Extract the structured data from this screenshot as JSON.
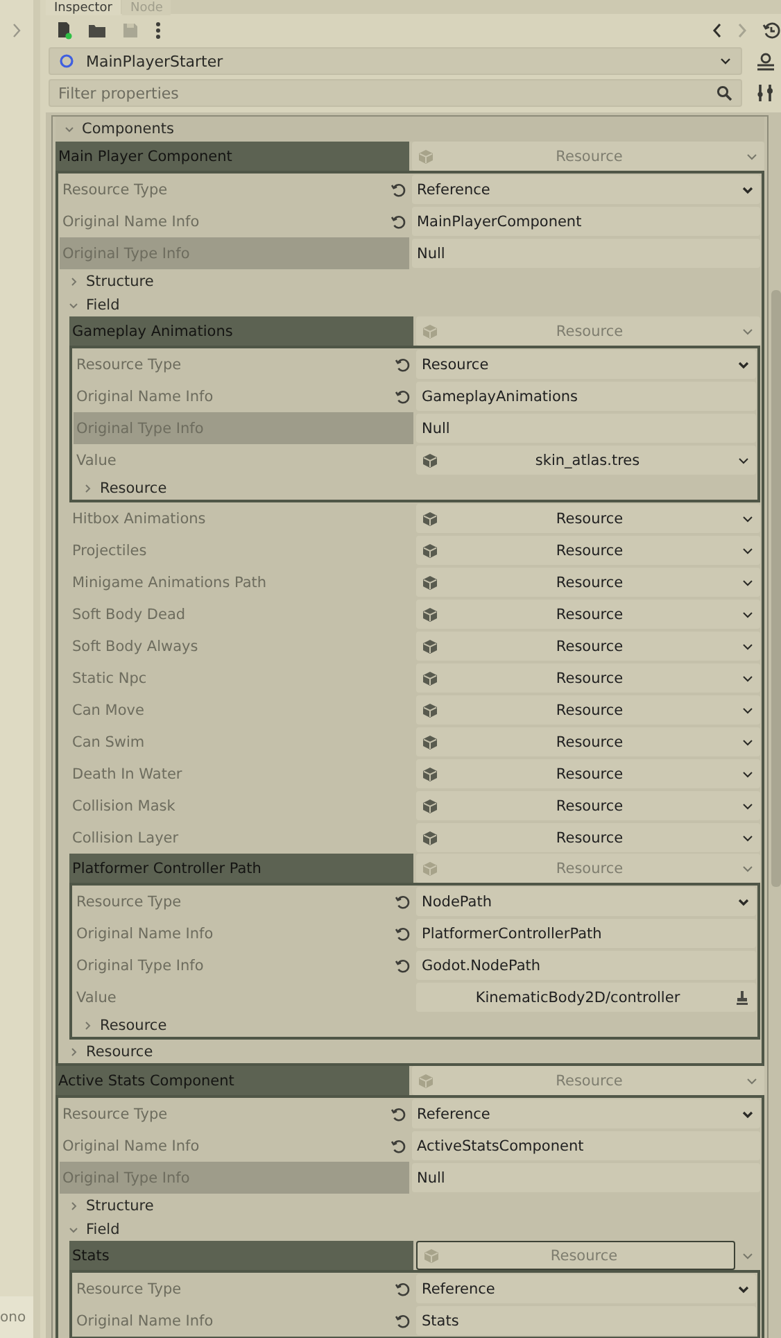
{
  "left_panel": {
    "bottom_label": "ono"
  },
  "tabs": [
    {
      "label": "Inspector",
      "selected": true
    },
    {
      "label": "Node",
      "selected": false
    }
  ],
  "object": {
    "name": "MainPlayerStarter"
  },
  "filter": {
    "placeholder": "Filter properties"
  },
  "section": {
    "label": "Components",
    "expanded": true,
    "children": [
      {
        "kind": "resource",
        "label": "Main Player Component",
        "value": "Resource",
        "expanded": true,
        "children": [
          {
            "kind": "dropdown",
            "label": "Resource Type",
            "value": "Reference",
            "revert": true,
            "highlighted": false
          },
          {
            "kind": "text",
            "label": "Original Name Info",
            "value": "MainPlayerComponent",
            "revert": true,
            "highlighted": false
          },
          {
            "kind": "text",
            "label": "Original Type Info",
            "value": "Null",
            "revert": false,
            "highlighted": true
          },
          {
            "kind": "group",
            "label": "Structure",
            "expanded": false
          },
          {
            "kind": "group",
            "label": "Field",
            "expanded": true,
            "children": [
              {
                "kind": "resource",
                "label": "Gameplay Animations",
                "value": "Resource",
                "expanded": true,
                "children": [
                  {
                    "kind": "dropdown",
                    "label": "Resource Type",
                    "value": "Resource",
                    "revert": true,
                    "highlighted": false
                  },
                  {
                    "kind": "text",
                    "label": "Original Name Info",
                    "value": "GameplayAnimations",
                    "revert": true,
                    "highlighted": false
                  },
                  {
                    "kind": "text",
                    "label": "Original Type Info",
                    "value": "Null",
                    "revert": false,
                    "highlighted": true
                  },
                  {
                    "kind": "picker",
                    "label": "Value",
                    "value": "skin_atlas.tres",
                    "revert": false,
                    "highlighted": false
                  },
                  {
                    "kind": "group",
                    "label": "Resource",
                    "expanded": false
                  }
                ]
              },
              {
                "kind": "resource",
                "label": "Hitbox Animations",
                "value": "Resource",
                "expanded": false
              },
              {
                "kind": "resource",
                "label": "Projectiles",
                "value": "Resource",
                "expanded": false
              },
              {
                "kind": "resource",
                "label": "Minigame Animations Path",
                "value": "Resource",
                "expanded": false
              },
              {
                "kind": "resource",
                "label": "Soft Body Dead",
                "value": "Resource",
                "expanded": false
              },
              {
                "kind": "resource",
                "label": "Soft Body Always",
                "value": "Resource",
                "expanded": false
              },
              {
                "kind": "resource",
                "label": "Static Npc",
                "value": "Resource",
                "expanded": false
              },
              {
                "kind": "resource",
                "label": "Can Move",
                "value": "Resource",
                "expanded": false
              },
              {
                "kind": "resource",
                "label": "Can Swim",
                "value": "Resource",
                "expanded": false
              },
              {
                "kind": "resource",
                "label": "Death In Water",
                "value": "Resource",
                "expanded": false
              },
              {
                "kind": "resource",
                "label": "Collision Mask",
                "value": "Resource",
                "expanded": false
              },
              {
                "kind": "resource",
                "label": "Collision Layer",
                "value": "Resource",
                "expanded": false
              },
              {
                "kind": "resource",
                "label": "Platformer Controller Path",
                "value": "Resource",
                "expanded": true,
                "children": [
                  {
                    "kind": "dropdown",
                    "label": "Resource Type",
                    "value": "NodePath",
                    "revert": true,
                    "highlighted": false
                  },
                  {
                    "kind": "text",
                    "label": "Original Name Info",
                    "value": "PlatformerControllerPath",
                    "revert": true,
                    "highlighted": false
                  },
                  {
                    "kind": "text",
                    "label": "Original Type Info",
                    "value": "Godot.NodePath",
                    "revert": true,
                    "highlighted": false
                  },
                  {
                    "kind": "path",
                    "label": "Value",
                    "value": "KinematicBody2D/controller",
                    "revert": false,
                    "highlighted": false
                  },
                  {
                    "kind": "group",
                    "label": "Resource",
                    "expanded": false
                  }
                ]
              }
            ]
          },
          {
            "kind": "group",
            "label": "Resource",
            "expanded": false
          }
        ]
      },
      {
        "kind": "resource",
        "label": "Active Stats Component",
        "value": "Resource",
        "expanded": true,
        "children": [
          {
            "kind": "dropdown",
            "label": "Resource Type",
            "value": "Reference",
            "revert": true,
            "highlighted": false
          },
          {
            "kind": "text",
            "label": "Original Name Info",
            "value": "ActiveStatsComponent",
            "revert": true,
            "highlighted": false
          },
          {
            "kind": "text",
            "label": "Original Type Info",
            "value": "Null",
            "revert": false,
            "highlighted": true
          },
          {
            "kind": "group",
            "label": "Structure",
            "expanded": false
          },
          {
            "kind": "group",
            "label": "Field",
            "expanded": true,
            "children": [
              {
                "kind": "resource",
                "label": "Stats",
                "value": "Resource",
                "expanded": true,
                "focused": true,
                "children": [
                  {
                    "kind": "dropdown",
                    "label": "Resource Type",
                    "value": "Reference",
                    "revert": true,
                    "highlighted": false
                  },
                  {
                    "kind": "text",
                    "label": "Original Name Info",
                    "value": "Stats",
                    "revert": true,
                    "highlighted": false
                  }
                ]
              }
            ]
          }
        ]
      }
    ]
  }
}
